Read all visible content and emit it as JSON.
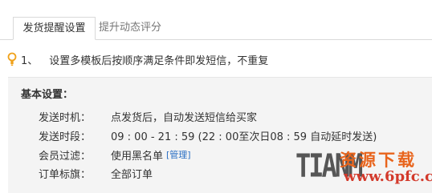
{
  "tabs": [
    {
      "label": "发货提醒设置",
      "active": true
    },
    {
      "label": "提升动态评分",
      "active": false
    }
  ],
  "tip": {
    "icon": "lightbulb-icon",
    "number": "1、",
    "text": "设置多模板后按顺序满足条件即发短信，不重复"
  },
  "settings": {
    "title": "基本设置：",
    "rows": [
      {
        "label": "发送时机：",
        "value": "点发货后，自动发送短信给买家"
      },
      {
        "label": "发送时段：",
        "value": "09 : 00 - 21 : 59 (22 : 00至次日08 : 59 自动延时发送)"
      },
      {
        "label": "会员过滤：",
        "value": "使用黑名单",
        "link": "[管理]"
      },
      {
        "label": "订单标旗：",
        "value": "全部订单"
      }
    ]
  },
  "watermark": {
    "latin": "TIANM",
    "chinese": "资源下载",
    "url": "www.6pfc.cn"
  },
  "colors": {
    "link": "#2a6fc4",
    "tip_icon": "#f0a21b",
    "panel_bg": "#f4f4f4",
    "border": "#d9d9d9"
  }
}
